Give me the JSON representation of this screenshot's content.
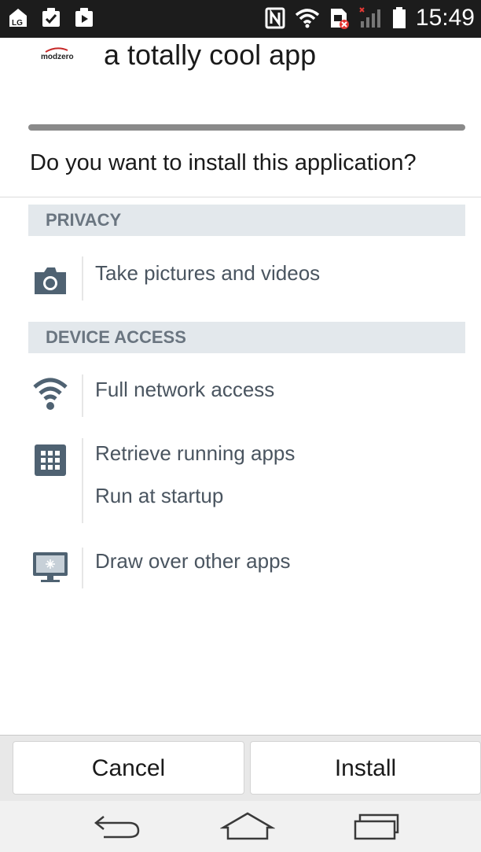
{
  "status_bar": {
    "time": "15:49",
    "carrier_badge": "LG",
    "left_icons": [
      "lg-carrier-icon",
      "checklist-clipboard-icon",
      "media-clipboard-icon"
    ],
    "right_icons": [
      "nfc-icon",
      "wifi-icon",
      "sim-error-icon",
      "signal-icon",
      "battery-icon"
    ]
  },
  "app": {
    "logo_text": "modzero",
    "name": "a totally cool app"
  },
  "prompt": "Do you want to install this application?",
  "sections": [
    {
      "header": "PRIVACY",
      "groups": [
        {
          "icon": "camera-icon",
          "permissions": [
            "Take pictures and videos"
          ]
        }
      ]
    },
    {
      "header": "DEVICE ACCESS",
      "groups": [
        {
          "icon": "wifi-icon",
          "permissions": [
            "Full network access"
          ]
        },
        {
          "icon": "apps-grid-icon",
          "permissions": [
            "Retrieve running apps",
            "Run at startup"
          ]
        },
        {
          "icon": "monitor-icon",
          "permissions": [
            "Draw over other apps"
          ]
        }
      ]
    }
  ],
  "buttons": {
    "cancel": "Cancel",
    "install": "Install"
  },
  "nav": [
    "back-icon",
    "home-icon",
    "recent-apps-icon"
  ],
  "colors": {
    "status_bar": "#1c1c1c",
    "section_bg": "#e3e8ec",
    "section_text": "#6a7580",
    "icon": "#4f6272",
    "sim_error": "#e53935"
  }
}
